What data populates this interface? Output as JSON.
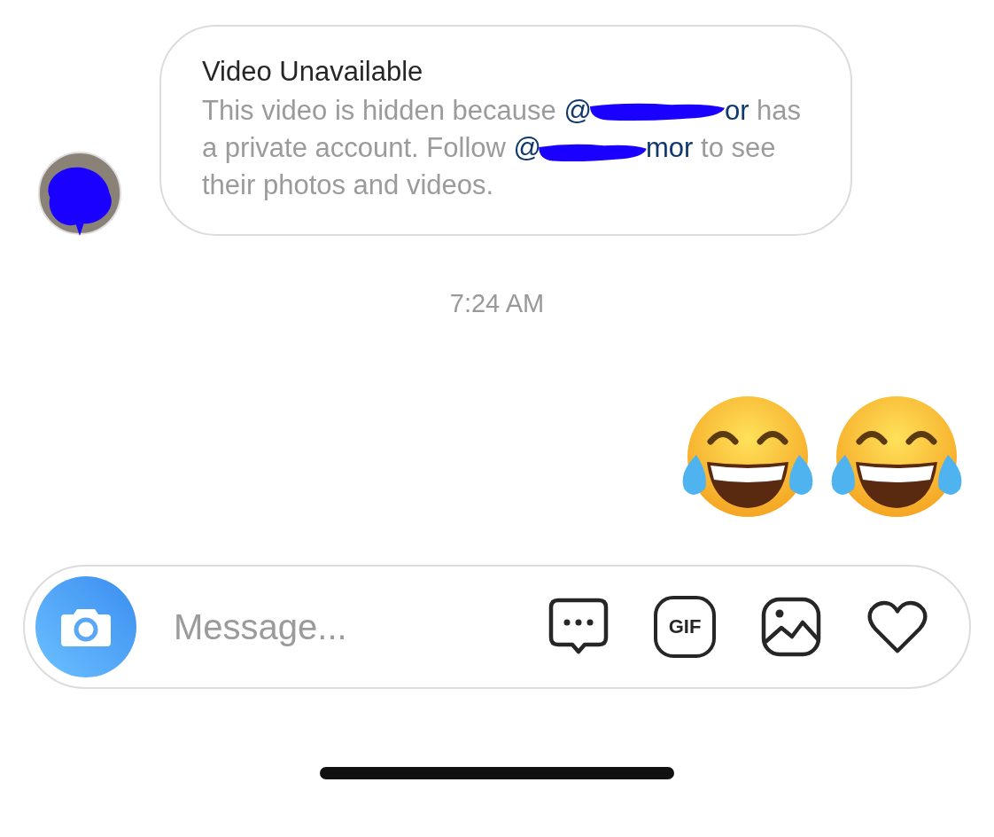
{
  "incoming_message": {
    "title": "Video Unavailable",
    "body": [
      {
        "kind": "text",
        "text": "This video is hidden because"
      },
      {
        "kind": "mention",
        "start": "@",
        "end": "or"
      },
      {
        "kind": "text",
        "text": "has a private account. Follow"
      },
      {
        "kind": "mention",
        "start": "@",
        "end": "mor"
      },
      {
        "kind": "text",
        "text": "to see their photos and videos."
      }
    ]
  },
  "timestamp": "7:24 AM",
  "sent_message": [
    {
      "kind": "tears-of-joy"
    },
    {
      "kind": "tears-of-joy"
    }
  ],
  "composer": {
    "placeholder": "Message...",
    "gif_label": "GIF"
  }
}
